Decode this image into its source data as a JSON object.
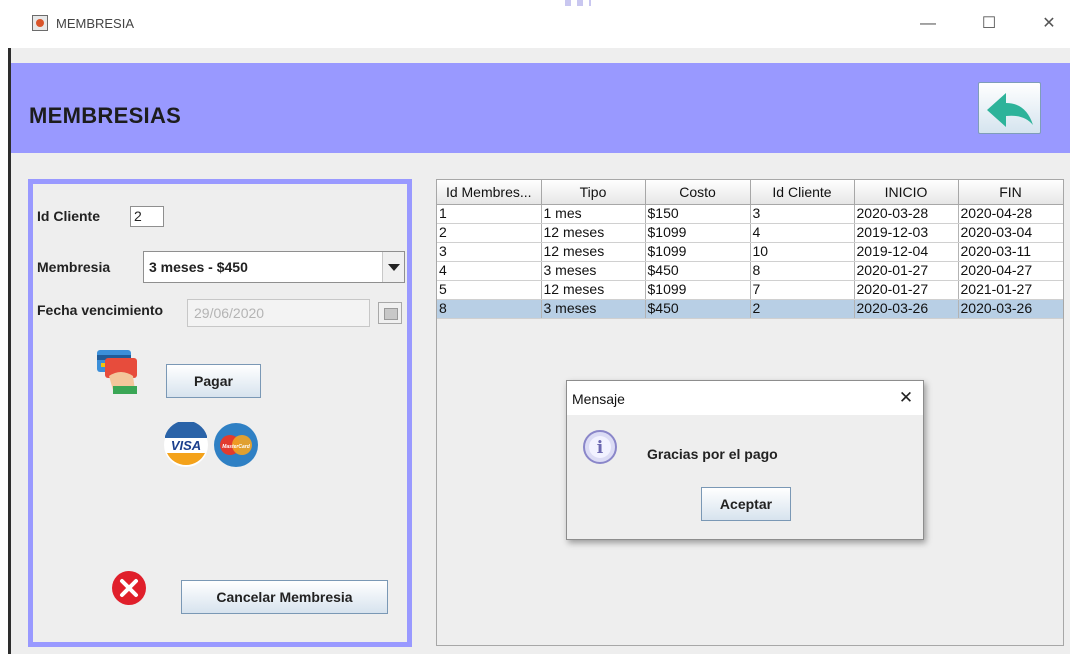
{
  "window": {
    "title": "MEMBRESIA",
    "min_glyph": "—",
    "max_glyph": "☐",
    "close_glyph": "✕"
  },
  "header": {
    "title": "MEMBRESIAS"
  },
  "form": {
    "id_cliente_label": "Id Cliente",
    "id_cliente_value": "2",
    "membresia_label": "Membresia",
    "membresia_selected": "3 meses - $450",
    "fecha_label": "Fecha vencimiento",
    "fecha_value": "29/06/2020",
    "pagar_button": "Pagar",
    "cancelar_button": "Cancelar Membresia",
    "visa_text": "VISA",
    "mastercard_text": "MasterCard"
  },
  "table": {
    "columns": [
      "Id Membres...",
      "Tipo",
      "Costo",
      "Id Cliente",
      "INICIO",
      "FIN"
    ],
    "rows": [
      [
        "1",
        "1 mes",
        "$150",
        "3",
        "2020-03-28",
        "2020-04-28"
      ],
      [
        "2",
        "12 meses",
        "$1099",
        "4",
        "2019-12-03",
        "2020-03-04"
      ],
      [
        "3",
        "12 meses",
        "$1099",
        "10",
        "2019-12-04",
        "2020-03-11"
      ],
      [
        "4",
        "3 meses",
        "$450",
        "8",
        "2020-01-27",
        "2020-04-27"
      ],
      [
        "5",
        "12 meses",
        "$1099",
        "7",
        "2020-01-27",
        "2021-01-27"
      ],
      [
        "8",
        "3 meses",
        "$450",
        "2",
        "2020-03-26",
        "2020-03-26"
      ]
    ],
    "selected_row": 5
  },
  "dialog": {
    "title": "Mensaje",
    "close_glyph": "✕",
    "info_glyph": "i",
    "message": "Gracias por el pago",
    "ok_button": "Aceptar"
  },
  "colors": {
    "header_bg": "#9999ff",
    "panel_border": "#9999ff",
    "selected_row": "#b8cfe5",
    "back_arrow": "#2db39a",
    "cancel_icon": "#e01f2b"
  },
  "icons": {
    "app": "java-cup-icon",
    "back": "back-arrow-icon",
    "payment": "credit-card-hand-icon",
    "cancel": "red-x-circle-icon",
    "info": "info-icon",
    "calendar": "calendar-icon"
  }
}
